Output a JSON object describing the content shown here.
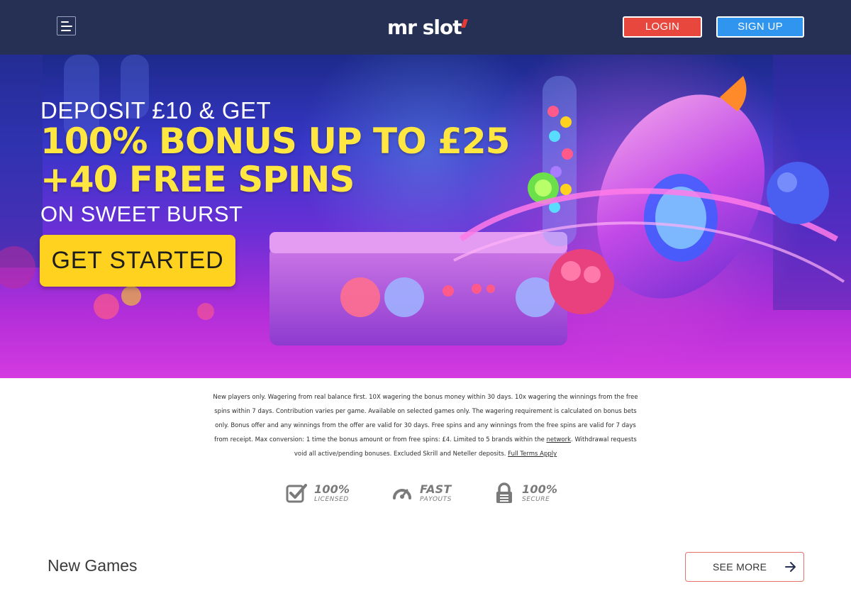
{
  "header": {
    "menu_icon": "hamburger-menu-icon",
    "logo_text": "mr slot",
    "login_label": "LOGIN",
    "signup_label": "SIGN UP"
  },
  "hero": {
    "line1": "DEPOSIT £10 & GET",
    "line2": "100% BONUS UP TO £25",
    "line3": "+40 FREE SPINS",
    "line4": "ON SWEET BURST",
    "cta_label": "GET STARTED"
  },
  "terms": {
    "text_before_network": "New players only. Wagering from real balance first. 10X wagering the bonus money within 30 days. 10x wagering the winnings from the free spins within 7 days. Contribution varies per game. Available on selected games only. The wagering requirement is calculated on bonus bets only. Bonus offer and any winnings from the offer are valid for 30 days. Free spins and any winnings from the free spins are valid for 7 days from receipt. Max conversion: 1 time the bonus amount or from free spins: £4. Limited to 5 brands within the ",
    "network_link": "network",
    "text_after_network": ". Withdrawal requests void all active/pending bonuses. Excluded Skrill and Neteller deposits. ",
    "full_terms_link": "Full Terms Apply"
  },
  "badges": [
    {
      "icon": "checkbox-icon",
      "big": "100%",
      "small": "LICENSED"
    },
    {
      "icon": "speedometer-icon",
      "big": "FAST",
      "small": "PAYOUTS"
    },
    {
      "icon": "padlock-icon",
      "big": "100%",
      "small": "SECURE"
    }
  ],
  "new_games": {
    "title": "New Games",
    "see_more_label": "SEE MORE"
  },
  "colors": {
    "header_bg": "#263055",
    "login_bg": "#e8473d",
    "signup_bg": "#2f95ef",
    "hero_headline": "#ffe640",
    "cta_bg": "#ffd21f",
    "see_more_border": "#e6736b"
  }
}
